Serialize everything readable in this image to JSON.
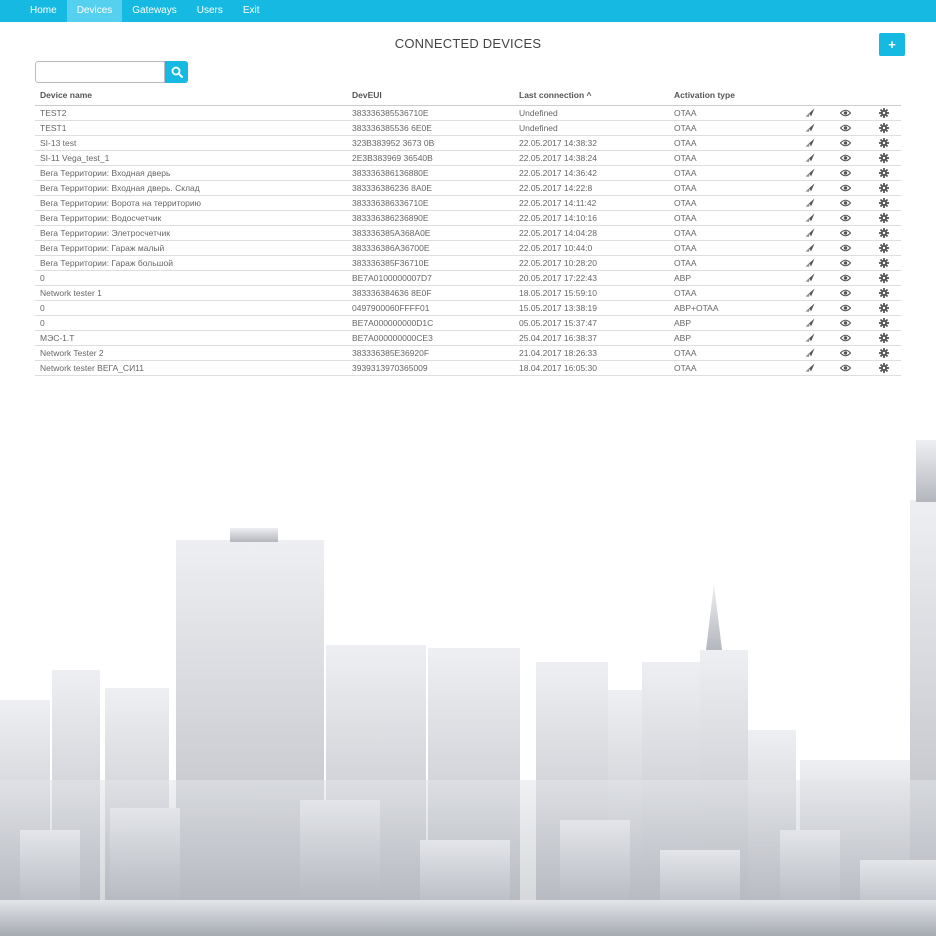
{
  "nav": {
    "items": [
      {
        "label": "Home",
        "active": false
      },
      {
        "label": "Devices",
        "active": true
      },
      {
        "label": "Gateways",
        "active": false
      },
      {
        "label": "Users",
        "active": false
      },
      {
        "label": "Exit",
        "active": false
      }
    ]
  },
  "header": {
    "title": "CONNECTED DEVICES",
    "add_label": "+"
  },
  "search": {
    "value": "",
    "placeholder": "",
    "icon": "search-icon"
  },
  "table": {
    "columns": [
      "Device name",
      "DevEUI",
      "Last connection ^",
      "Activation type",
      "",
      "",
      ""
    ],
    "action_icons": [
      "send-icon",
      "eye-icon",
      "gear-icon"
    ],
    "rows": [
      {
        "name": "TEST2",
        "deveui": "383336385536710E",
        "last": "Undefined",
        "type": "OTAA"
      },
      {
        "name": "TEST1",
        "deveui": "383336385536 6E0E",
        "last": "Undefined",
        "type": "OTAA"
      },
      {
        "name": "SI-13 test",
        "deveui": "323B383952 3673 0B",
        "last": "22.05.2017 14:38:32",
        "type": "OTAA"
      },
      {
        "name": "SI-11 Vega_test_1",
        "deveui": "2E3B383969 36540B",
        "last": "22.05.2017 14:38:24",
        "type": "OTAA"
      },
      {
        "name": "Вега Территории: Входная дверь",
        "deveui": "383336386136880E",
        "last": "22.05.2017 14:36:42",
        "type": "OTAA"
      },
      {
        "name": "Вега Территории: Входная дверь. Склад",
        "deveui": "383336386236 8A0E",
        "last": "22.05.2017 14:22:8",
        "type": "OTAA"
      },
      {
        "name": "Вега Территории: Ворота на территорию",
        "deveui": "383336386336710E",
        "last": "22.05.2017 14:11:42",
        "type": "OTAA"
      },
      {
        "name": "Вега Территории: Водосчетчик",
        "deveui": "383336386236890E",
        "last": "22.05.2017 14:10:16",
        "type": "OTAA"
      },
      {
        "name": "Вега Территории: Элетросчетчик",
        "deveui": "383336385A368A0E",
        "last": "22.05.2017 14:04:28",
        "type": "OTAA"
      },
      {
        "name": "Вега Территории: Гараж малый",
        "deveui": "383336386A36700E",
        "last": "22.05.2017 10:44:0",
        "type": "OTAA"
      },
      {
        "name": "Вега Территории: Гараж большой",
        "deveui": "383336385F36710E",
        "last": "22.05.2017 10:28:20",
        "type": "OTAA"
      },
      {
        "name": "0",
        "deveui": "BE7A0100000007D7",
        "last": "20.05.2017 17:22:43",
        "type": "ABP"
      },
      {
        "name": "Network tester 1",
        "deveui": "383336384636 8E0F",
        "last": "18.05.2017 15:59:10",
        "type": "OTAA"
      },
      {
        "name": "0",
        "deveui": "0497900060FFFF01",
        "last": "15.05.2017 13:38:19",
        "type": "ABP+OTAA"
      },
      {
        "name": "0",
        "deveui": "BE7A000000000D1C",
        "last": "05.05.2017 15:37:47",
        "type": "ABP"
      },
      {
        "name": "МЭС-1.Т",
        "deveui": "BE7A000000000CE3",
        "last": "25.04.2017 16:38:37",
        "type": "ABP"
      },
      {
        "name": "Network Tester 2",
        "deveui": "383336385E36920F",
        "last": "21.04.2017 18:26:33",
        "type": "OTAA"
      },
      {
        "name": "Network tester ВЕГА_СИ11",
        "deveui": "3939313970365009",
        "last": "18.04.2017 16:05:30",
        "type": "OTAA"
      }
    ]
  },
  "colors": {
    "accent": "#16b9e1",
    "nav_active": "#55d0ee"
  }
}
